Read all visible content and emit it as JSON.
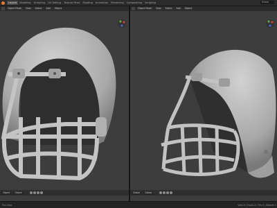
{
  "topbar": {
    "tabs": [
      "Layout",
      "Modeling",
      "Sculpting",
      "UV Editing",
      "Texture Paint",
      "Shading",
      "Animation",
      "Rendering",
      "Compositing",
      "Scripting"
    ],
    "active_tab": "Layout",
    "scene": "Scene"
  },
  "viewport_left": {
    "header": [
      "Object Mode",
      "View",
      "Select",
      "Add",
      "Object"
    ],
    "bottom": [
      "Object",
      "Object"
    ]
  },
  "viewport_right": {
    "header": [
      "Object Mode",
      "View",
      "Select",
      "Add",
      "Object"
    ],
    "bottom": [
      "Global",
      "Global"
    ]
  },
  "statusbar": {
    "left": "Pan View",
    "right": "Verts 0 | Faces 0 | Tris 0 | Objects 1"
  },
  "colors": {
    "viewport_bg": "#3d3d3d",
    "helmet": "#bdbdbd",
    "accent": "#e07a2f"
  },
  "icons": [
    "blender-logo-icon",
    "axis-gizmo-icon",
    "viewport-shading-icon"
  ]
}
